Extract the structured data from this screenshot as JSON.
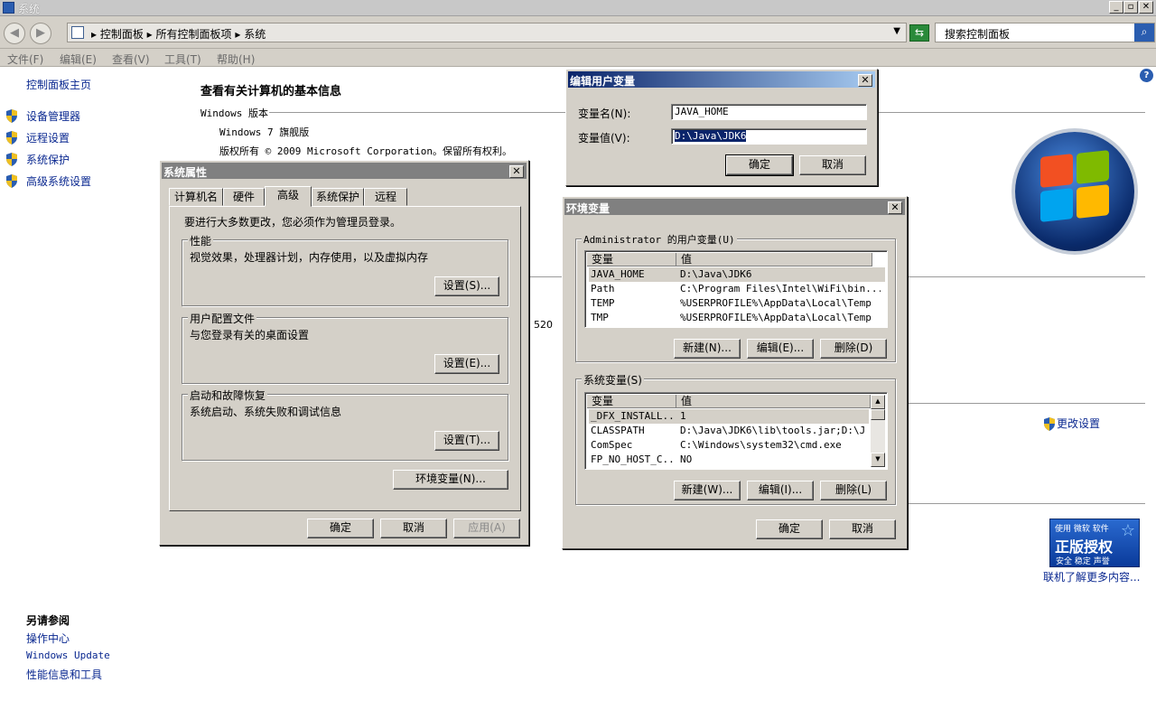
{
  "window": {
    "title": "系统"
  },
  "address": {
    "crumbs": [
      "控制面板",
      "所有控制面板项",
      "系统"
    ],
    "search_placeholder": "搜索控制面板"
  },
  "menu": [
    "文件(F)",
    "编辑(E)",
    "查看(V)",
    "工具(T)",
    "帮助(H)"
  ],
  "sidebar": {
    "home": "控制面板主页",
    "items": [
      "设备管理器",
      "远程设置",
      "系统保护",
      "高级系统设置"
    ],
    "see_also_title": "另请参阅",
    "see_also": [
      "操作中心",
      "Windows Update",
      "性能信息和工具"
    ]
  },
  "main": {
    "heading": "查看有关计算机的基本信息",
    "edition_label": "Windows 版本",
    "edition": "Windows 7 旗舰版",
    "copyright": "版权所有 © 2009 Microsoft Corporation。保留所有权利。",
    "partial_value": "520",
    "change_settings": "更改设置",
    "genuine": {
      "top": "使用 微软 软件",
      "big": "正版授权",
      "sub": "安全 稳定 声誉"
    },
    "more_online": "联机了解更多内容..."
  },
  "sysprops": {
    "title": "系统属性",
    "tabs": [
      "计算机名",
      "硬件",
      "高级",
      "系统保护",
      "远程"
    ],
    "selected_tab": "高级",
    "admin_note": "要进行大多数更改，您必须作为管理员登录。",
    "perf": {
      "label": "性能",
      "desc": "视觉效果，处理器计划，内存使用，以及虚拟内存",
      "button": "设置(S)..."
    },
    "profile": {
      "label": "用户配置文件",
      "desc": "与您登录有关的桌面设置",
      "button": "设置(E)..."
    },
    "startup": {
      "label": "启动和故障恢复",
      "desc": "系统启动、系统失败和调试信息",
      "button": "设置(T)..."
    },
    "env_button": "环境变量(N)...",
    "ok": "确定",
    "cancel": "取消",
    "apply": "应用(A)"
  },
  "envvars": {
    "title": "环境变量",
    "user_group": "Administrator 的用户变量(U)",
    "col_var": "变量",
    "col_val": "值",
    "user_vars": [
      {
        "name": "JAVA_HOME",
        "value": "D:\\Java\\JDK6"
      },
      {
        "name": "Path",
        "value": "C:\\Program Files\\Intel\\WiFi\\bin..."
      },
      {
        "name": "TEMP",
        "value": "%USERPROFILE%\\AppData\\Local\\Temp"
      },
      {
        "name": "TMP",
        "value": "%USERPROFILE%\\AppData\\Local\\Temp"
      }
    ],
    "user_buttons": [
      "新建(N)...",
      "编辑(E)...",
      "删除(D)"
    ],
    "sys_group": "系统变量(S)",
    "sys_vars": [
      {
        "name": "_DFX_INSTALL...",
        "value": "1"
      },
      {
        "name": "CLASSPATH",
        "value": "D:\\Java\\JDK6\\lib\\tools.jar;D:\\J..."
      },
      {
        "name": "ComSpec",
        "value": "C:\\Windows\\system32\\cmd.exe"
      },
      {
        "name": "FP_NO_HOST_C...",
        "value": "NO"
      }
    ],
    "sys_buttons": [
      "新建(W)...",
      "编辑(I)...",
      "删除(L)"
    ],
    "ok": "确定",
    "cancel": "取消"
  },
  "edituser": {
    "title": "编辑用户变量",
    "name_label": "变量名(N):",
    "name_value": "JAVA_HOME",
    "value_label": "变量值(V):",
    "value_value": "D:\\Java\\JDK6",
    "ok": "确定",
    "cancel": "取消"
  },
  "colors": {
    "link": "#0a2890",
    "dialog_bg": "#d4d0c8",
    "active_title": "#0a246a",
    "inactive_title": "#808080"
  }
}
